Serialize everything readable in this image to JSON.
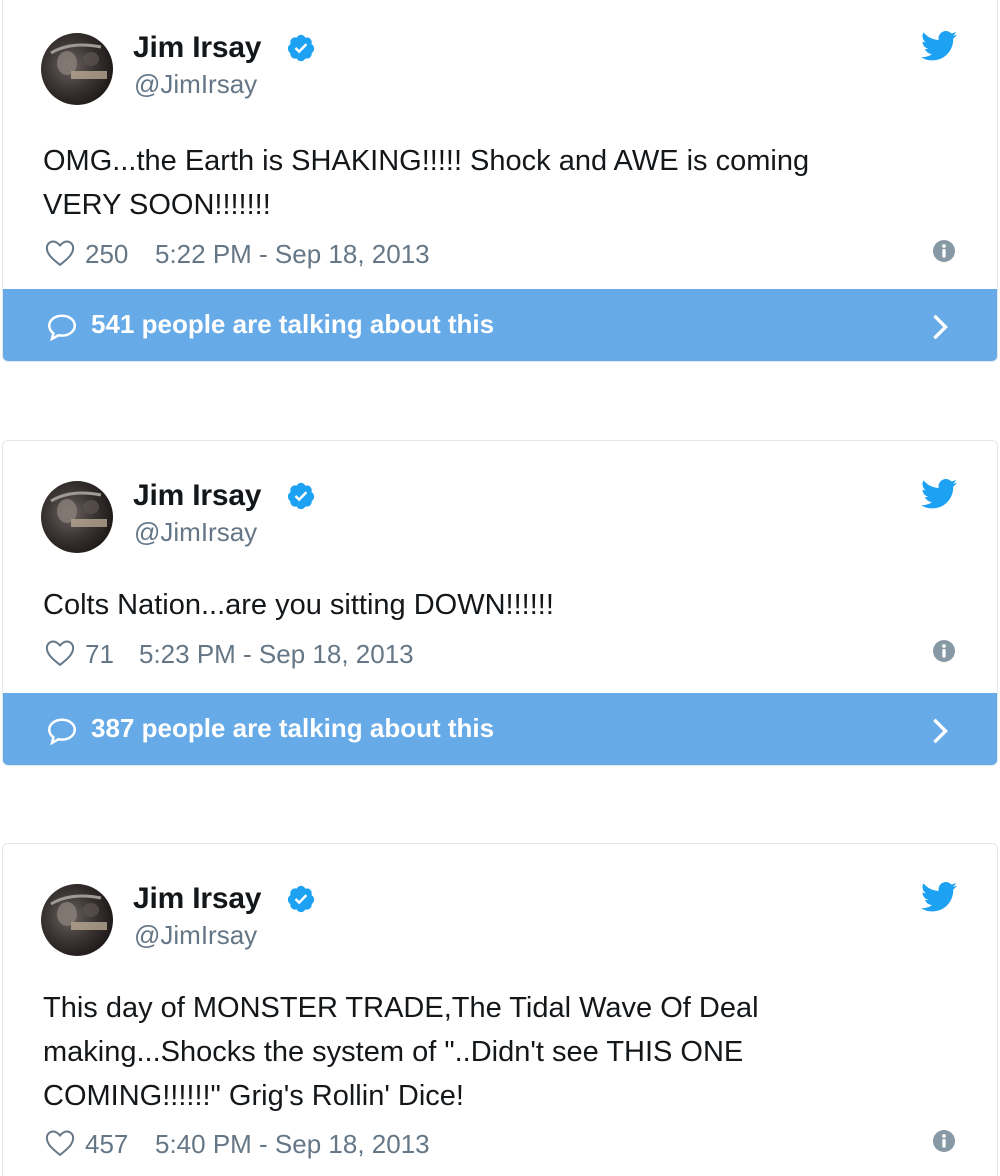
{
  "colors": {
    "accent": "#1da1f2",
    "talk_bar": "#66aae8",
    "muted": "#657786",
    "text": "#14171a"
  },
  "tweets": [
    {
      "name": "Jim Irsay",
      "handle": "@JimIrsay",
      "text_lines": [
        "OMG...the Earth is SHAKING!!!!! Shock and AWE is coming",
        "VERY SOON!!!!!!!"
      ],
      "likes": "250",
      "time": "5:22 PM - Sep 18, 2013",
      "talking": "541 people are talking about this"
    },
    {
      "name": "Jim Irsay",
      "handle": "@JimIrsay",
      "text_lines": [
        "Colts Nation...are you sitting DOWN!!!!!!"
      ],
      "likes": "71",
      "time": "5:23 PM - Sep 18, 2013",
      "talking": "387 people are talking about this"
    },
    {
      "name": "Jim Irsay",
      "handle": "@JimIrsay",
      "text_lines": [
        "This day of MONSTER TRADE,The Tidal Wave Of Deal",
        "making...Shocks the system of \"..Didn't see THIS ONE",
        "COMING!!!!!!\" Grig's Rollin' Dice!"
      ],
      "likes": "457",
      "time": "5:40 PM - Sep 18, 2013"
    }
  ],
  "icons": [
    "avatar",
    "verified-badge-icon",
    "twitter-bird-icon",
    "heart-icon",
    "info-icon",
    "speech-bubble-icon",
    "chevron-right-icon"
  ]
}
